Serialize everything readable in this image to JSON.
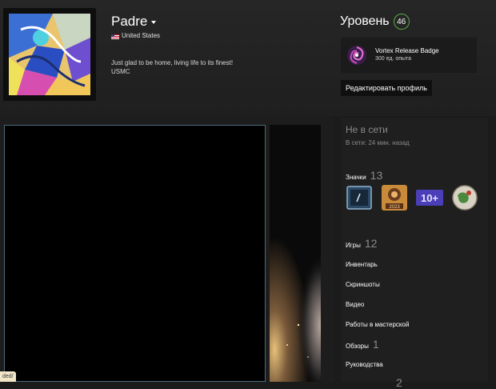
{
  "profile": {
    "username": "Padre",
    "country": "United States",
    "summary_line1": "Just glad to be home, living life to its finest!",
    "summary_line2": "USMC"
  },
  "level": {
    "label": "Уровень",
    "value": "46"
  },
  "featured_badge": {
    "name": "Vortex Release Badge",
    "xp": "300 ед. опыта"
  },
  "edit_profile_label": "Редактировать профиль",
  "status": {
    "online": "Не в сети",
    "last_online": "В сети: 24 мин. назад"
  },
  "badges": {
    "label": "Значки",
    "count": "13",
    "items": [
      "game-badge-icon",
      "steam-2023-badge-icon",
      "years-10-badge-icon",
      "globe-badge-icon"
    ],
    "years_label": "10+",
    "steam_year": "2023"
  },
  "games": {
    "label": "Игры",
    "count": "12"
  },
  "nav": {
    "inventory": "Инвентарь",
    "screenshots": "Скриншоты",
    "videos": "Видео",
    "workshop": "Работы в мастерской",
    "reviews": "Обзоры",
    "reviews_count": "1",
    "guides": "Руководства",
    "next_count": "2"
  },
  "bottom_tag": "ded/",
  "colors": {
    "level_ring": "#5bac46",
    "showcase_border": "#4a6b7a"
  }
}
